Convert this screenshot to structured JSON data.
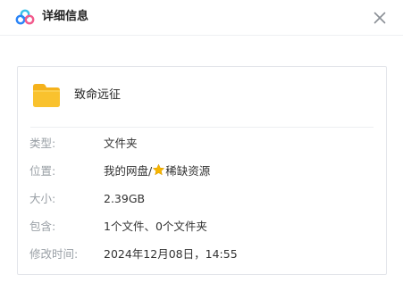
{
  "dialog": {
    "title": "详细信息",
    "logo_icon": "baidu-netdisk-cloud-icon",
    "close_icon": "close-icon"
  },
  "file": {
    "name": "致命远征",
    "icon": "folder-icon"
  },
  "details": [
    {
      "label": "类型:",
      "value": "文件夹"
    },
    {
      "label": "位置:",
      "value_prefix": "我的网盘/",
      "value_icon": "star-icon",
      "value_suffix": "稀缺资源"
    },
    {
      "label": "大小:",
      "value": "2.39GB"
    },
    {
      "label": "包含:",
      "value": "1个文件、0个文件夹"
    },
    {
      "label": "修改时间:",
      "value": "2024年12月08日，14:55"
    }
  ],
  "colors": {
    "folder": "#f9c22e",
    "folder_back": "#f5b21c",
    "star": "#f7b500",
    "logo_blue": "#2a84f7",
    "logo_pink": "#f25a8c",
    "logo_cyan": "#3ac2e8"
  }
}
